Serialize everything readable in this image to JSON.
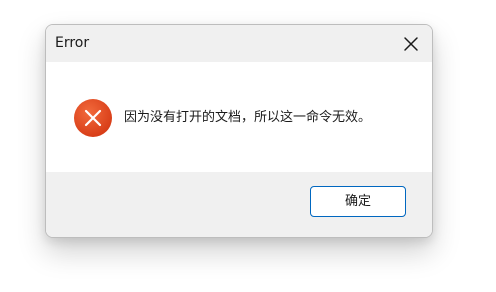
{
  "dialog": {
    "title": "Error",
    "message": "因为没有打开的文档，所以这一命令无效。",
    "ok_label": "确定",
    "icon": "error-icon",
    "close_icon": "close-icon"
  },
  "colors": {
    "error_icon": "#e0451f",
    "button_border": "#0067c0",
    "titlebar_bg": "#f0f0f0",
    "footer_bg": "#f0f0f0"
  }
}
